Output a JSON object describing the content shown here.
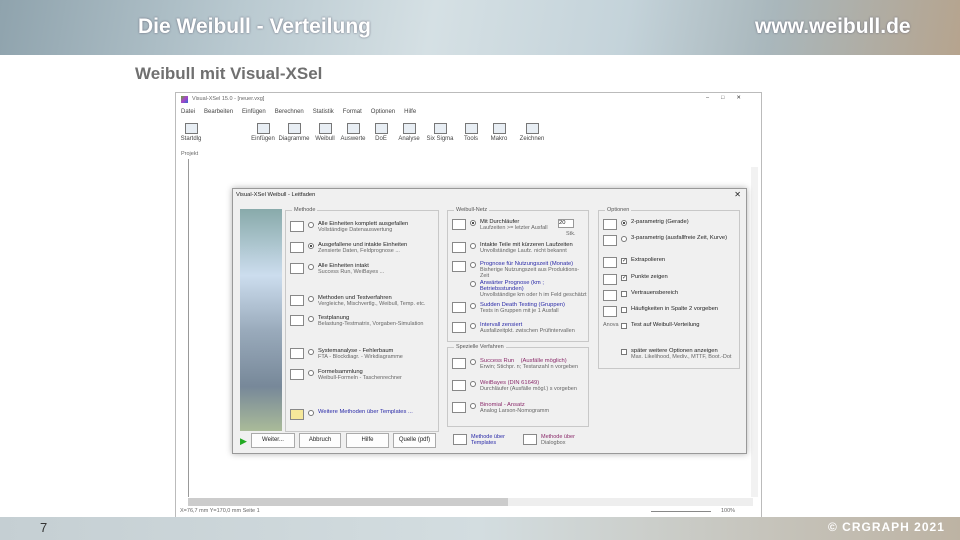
{
  "slide": {
    "title": "Die Weibull - Verteilung",
    "website": "www.weibull.de",
    "subtitle": "Weibull mit Visual-XSel",
    "page_number": "7",
    "copyright": "© CRGRAPH 2021"
  },
  "app": {
    "title": "Visual-XSel 15.0 - [neuer.vxg]",
    "menu": [
      "Datei",
      "Bearbeiten",
      "Einfügen",
      "Berechnen",
      "Statistik",
      "Format",
      "Optionen",
      "Hilfe"
    ],
    "toolbar": [
      "Startdlg",
      "Einfügen",
      "Diagramme",
      "Weibull",
      "Auswerte",
      "DoE",
      "Analyse",
      "Six Sigma",
      "Tools",
      "Makro",
      "Zeichnen"
    ],
    "project_label": "Projekt",
    "status": {
      "coords": "X=76,7 mm  Y=170,0 mm  Seite 1",
      "zoom": "100%"
    }
  },
  "dialog": {
    "title": "Visual-XSel   Weibull - Leitfaden",
    "methode": {
      "label": "Methode",
      "items": [
        {
          "title": "Alle Einheiten komplett ausgefallen",
          "desc": "Vollständige Datenauswertung",
          "selected": false
        },
        {
          "title": "Ausgefallene und intakte Einheiten",
          "desc": "Zensierte Daten, Feldprognose ...",
          "selected": true
        },
        {
          "title": "Alle Einheiten intakt",
          "desc": "Success Run, WeiBayes ...",
          "selected": false
        },
        {
          "title": "Methoden und Testverfahren",
          "desc": "Vergleiche, Mischvertlg., Weibull, Temp. etc.",
          "selected": false
        },
        {
          "title": "Testplanung",
          "desc": "Belastung-Testmatrix, Vorgaben-Simulation",
          "selected": false
        },
        {
          "title": "Systemanalyse - Fehlerbaum",
          "desc": "FTA - Blockdiagr. - Wirkdiagramme",
          "selected": false
        },
        {
          "title": "Formelsammlung",
          "desc": "Weibull-Formeln - Taschenrechner",
          "selected": false
        },
        {
          "title": "Weitere Methoden über Templates ...",
          "desc": "",
          "selected": false
        }
      ]
    },
    "netz": {
      "label": "Weibull-Netz",
      "count": "20",
      "unit": "Stk.",
      "items": [
        {
          "title": "Mit Durchläufer",
          "desc": "Laufzeiten >= letzter Ausfall",
          "selected": true
        },
        {
          "title": "Intakte Teile mit kürzeren Laufzeiten",
          "desc": "Unvollständige Laufz. nicht bekannt",
          "selected": false
        },
        {
          "title": "Prognose für Nutzungszeit (Monate)",
          "desc": "Bisherige Nutzungszeit aus Produktions-Zeit",
          "selected": false
        },
        {
          "title": "Anwärter Prognose (km ; Betriebsstunden)",
          "desc": "Unvollständige km oder h im Feld geschätzt",
          "selected": false
        },
        {
          "title": "Sudden Death Testing (Gruppen)",
          "desc": "Tests in Gruppen mit je 1 Ausfall",
          "selected": false
        },
        {
          "title": "Intervall zensiert",
          "desc": "Ausfallzeitpkt. zwischen Prüfintervallen",
          "selected": false
        }
      ]
    },
    "spezial": {
      "label": "Spezielle Verfahren",
      "items": [
        {
          "title": "Success Run",
          "note": "(Ausfälle möglich)",
          "desc": "Erwin; Stichpr. n; Testanzahl n vorgeben"
        },
        {
          "title": "WeiBayes (DIN 61649)",
          "note": "",
          "desc": "Durchläufer (Ausfälle mögl.) s vorgeben"
        },
        {
          "title": "Binomial - Ansatz",
          "note": "",
          "desc": "Analog Larson-Nomogramm"
        }
      ]
    },
    "optionen": {
      "label": "Optionen",
      "items": [
        {
          "title": "2-parametrig (Gerade)",
          "type": "radio",
          "checked": true
        },
        {
          "title": "3-parametrig (ausfallfreie Zeit, Kurve)",
          "type": "radio",
          "checked": false
        },
        {
          "title": "Extrapolieren",
          "type": "check",
          "checked": true
        },
        {
          "title": "Punkte zeigen",
          "type": "check",
          "checked": true
        },
        {
          "title": "Vertrauensbereich",
          "type": "check",
          "checked": false
        },
        {
          "title": "Häufigkeiten in Spalte 2 vorgeben",
          "type": "check",
          "checked": false
        },
        {
          "title": "Test auf Weibull-Verteilung",
          "type": "check",
          "checked": false,
          "prefix": "Anova"
        },
        {
          "title": "später weitere Optionen anzeigen",
          "type": "check",
          "checked": false,
          "desc": "Max. Likelihood, Mediv., MTTF, Boot.-Dot"
        }
      ]
    },
    "buttons": {
      "next": "Weiter...",
      "cancel": "Abbruch",
      "help": "Hilfe",
      "source": "Quelle (pdf)"
    },
    "links": {
      "templates": [
        "Methode über",
        "Templates"
      ],
      "dialogbox": [
        "Methode über",
        "Dialogbox"
      ]
    }
  }
}
